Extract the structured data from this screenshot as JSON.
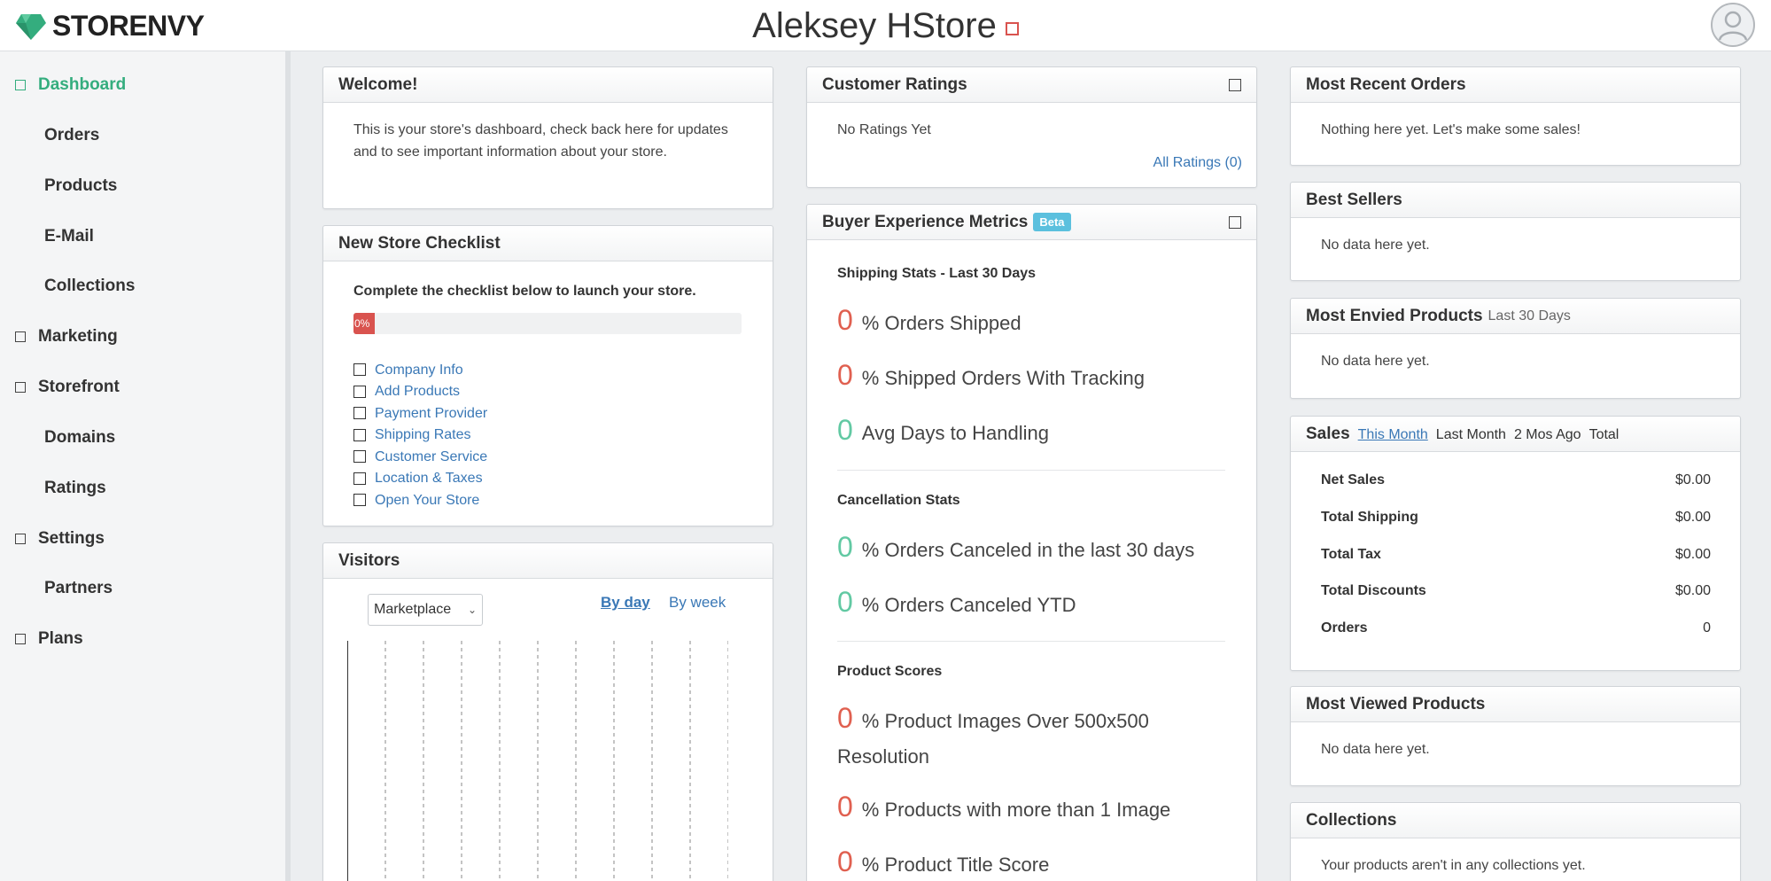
{
  "header": {
    "logo_text": "STORENVY",
    "store_name": "Aleksey HStore",
    "brand_color": "#34ad7e"
  },
  "sidebar": {
    "items": [
      {
        "label": "Dashboard",
        "icon": "square-icon",
        "active": true
      },
      {
        "label": "Orders"
      },
      {
        "label": "Products"
      },
      {
        "label": "E-Mail"
      },
      {
        "label": "Collections"
      },
      {
        "label": "Marketing",
        "icon": "square-icon"
      },
      {
        "label": "Storefront",
        "icon": "square-icon"
      },
      {
        "label": "Domains"
      },
      {
        "label": "Ratings"
      },
      {
        "label": "Settings",
        "icon": "square-icon"
      },
      {
        "label": "Partners"
      },
      {
        "label": "Plans",
        "icon": "square-icon"
      }
    ]
  },
  "welcome": {
    "title": "Welcome!",
    "text": "This is your store's dashboard, check back here for updates and to see important information about your store."
  },
  "checklist": {
    "title": "New Store Checklist",
    "instruction": "Complete the checklist below to launch your store.",
    "progress_label": "0%",
    "progress_value": 0,
    "items": [
      "Company Info",
      "Add Products",
      "Payment Provider",
      "Shipping Rates",
      "Customer Service",
      "Location & Taxes",
      "Open Your Store"
    ]
  },
  "visitors": {
    "title": "Visitors",
    "select_value": "Marketplace",
    "tab_by_day": "By day",
    "tab_by_week": "By week"
  },
  "ratings": {
    "title": "Customer Ratings",
    "empty_text": "No Ratings Yet",
    "all_link": "All Ratings (0)"
  },
  "metrics": {
    "title": "Buyer Experience Metrics",
    "badge": "Beta",
    "shipping_title": "Shipping Stats - Last 30 Days",
    "shipping": [
      {
        "value": "0",
        "label": "% Orders Shipped",
        "status": "red"
      },
      {
        "value": "0",
        "label": "% Shipped Orders With Tracking",
        "status": "red"
      },
      {
        "value": "0",
        "label": "Avg Days to Handling",
        "status": "green"
      }
    ],
    "cancel_title": "Cancellation Stats",
    "cancel": [
      {
        "value": "0",
        "label": "% Orders Canceled in the last 30 days",
        "status": "green"
      },
      {
        "value": "0",
        "label": "% Orders Canceled YTD",
        "status": "green"
      }
    ],
    "product_title": "Product Scores",
    "product": [
      {
        "value": "0",
        "label": "% Product Images Over 500x500",
        "label_cont": "Resolution",
        "status": "red"
      },
      {
        "value": "0",
        "label": "% Products with more than 1 Image",
        "status": "red"
      },
      {
        "value": "0",
        "label": "% Product Title Score",
        "status": "red"
      }
    ],
    "colors": {
      "red": "#e06050",
      "green": "#62c9a3"
    }
  },
  "recent_orders": {
    "title": "Most Recent Orders",
    "text": "Nothing here yet. Let's make some sales!"
  },
  "best_sellers": {
    "title": "Best Sellers",
    "text": "No data here yet."
  },
  "envied": {
    "title": "Most Envied Products",
    "sub": "Last 30 Days",
    "text": "No data here yet."
  },
  "sales": {
    "title": "Sales",
    "tabs": [
      "This Month",
      "Last Month",
      "2 Mos Ago",
      "Total"
    ],
    "rows": [
      {
        "label": "Net Sales",
        "value": "$0.00"
      },
      {
        "label": "Total Shipping",
        "value": "$0.00"
      },
      {
        "label": "Total Tax",
        "value": "$0.00"
      },
      {
        "label": "Total Discounts",
        "value": "$0.00"
      },
      {
        "label": "Orders",
        "value": "0"
      }
    ]
  },
  "viewed": {
    "title": "Most Viewed Products",
    "text": "No data here yet."
  },
  "collections": {
    "title": "Collections",
    "text": "Your products aren't in any collections yet."
  }
}
